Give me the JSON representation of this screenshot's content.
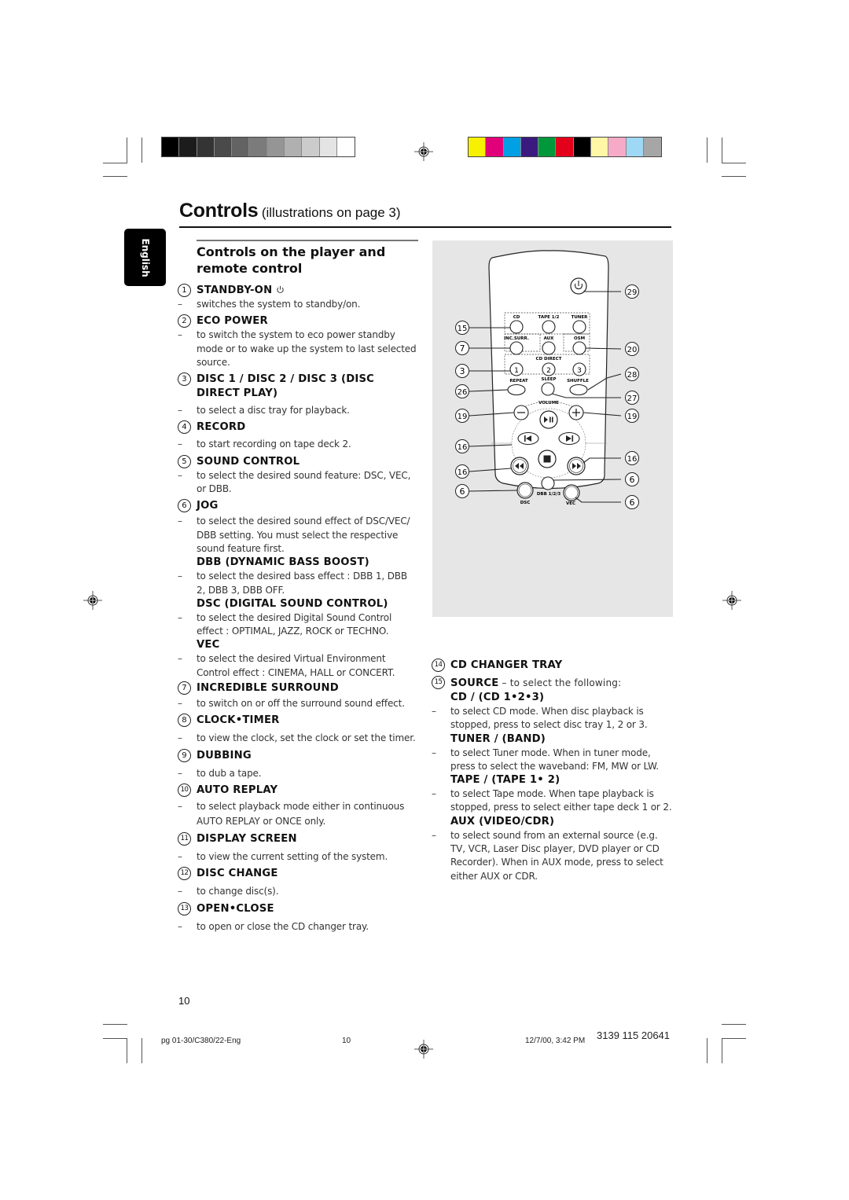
{
  "print_marks": {
    "grayscale_bars": [
      "#000000",
      "#1c1c1c",
      "#343434",
      "#4a4a4a",
      "#636363",
      "#7b7b7b",
      "#959595",
      "#b0b0b0",
      "#cbcbcb",
      "#e4e4e4",
      "#ffffff"
    ],
    "color_bars": [
      "#f7f000",
      "#e2007a",
      "#00a0e4",
      "#3a1a7f",
      "#00983a",
      "#e3001b",
      "#000000",
      "#fff7a6",
      "#f6aac6",
      "#9fd8f4",
      "#a6a6a6"
    ]
  },
  "header": {
    "title": "Controls",
    "subtitle": "(illustrations on page 3)",
    "language_tab": "English"
  },
  "section": {
    "heading_line1": "Controls on the player and",
    "heading_line2": "remote control"
  },
  "items_left": [
    {
      "num": "1",
      "title": "STANDBY-ON",
      "icon": "power-icon",
      "desc": [
        "switches the system to standby/on."
      ]
    },
    {
      "num": "2",
      "title": "ECO POWER",
      "desc": [
        "to switch the system to eco power standby mode or to wake up the system to last selected source."
      ]
    },
    {
      "num": "3",
      "title": "DISC 1 / DISC 2 / DISC 3 (DISC DIRECT PLAY)",
      "desc": [
        "to select a disc tray for playback."
      ]
    },
    {
      "num": "4",
      "title": "RECORD",
      "desc": [
        "to start recording on tape deck 2."
      ]
    },
    {
      "num": "5",
      "title": "SOUND CONTROL",
      "desc": [
        "to select the desired sound feature: DSC, VEC, or DBB."
      ]
    },
    {
      "num": "6",
      "title": "JOG",
      "desc": [
        "to select the desired sound effect of DSC/VEC/ DBB setting.  You must select the respective sound feature first."
      ],
      "subs": [
        {
          "title": "DBB (DYNAMIC BASS BOOST)",
          "desc": "to select the desired bass effect : DBB 1, DBB 2, DBB 3, DBB OFF."
        },
        {
          "title": "DSC (DIGITAL SOUND CONTROL)",
          "desc": "to select the desired Digital Sound Control effect : OPTIMAL, JAZZ, ROCK or TECHNO."
        },
        {
          "title": "VEC",
          "desc": "to select the desired Virtual Environment Control effect : CINEMA, HALL or CONCERT."
        }
      ]
    },
    {
      "num": "7",
      "title": "INCREDIBLE SURROUND",
      "desc": [
        "to switch on or off the surround sound effect."
      ]
    },
    {
      "num": "8",
      "title": "CLOCK•TIMER",
      "desc": [
        "to view the clock, set the clock or set the timer."
      ]
    },
    {
      "num": "9",
      "title": "DUBBING",
      "desc": [
        "to dub a tape."
      ]
    },
    {
      "num": "10",
      "title": "AUTO REPLAY",
      "desc": [
        "to select playback mode either in continuous AUTO REPLAY or ONCE only."
      ]
    },
    {
      "num": "11",
      "title": "DISPLAY SCREEN",
      "desc": [
        "to view the current setting of the system."
      ]
    },
    {
      "num": "12",
      "title": "DISC CHANGE",
      "desc": [
        "to change disc(s)."
      ]
    },
    {
      "num": "13",
      "title": "OPEN•CLOSE",
      "desc": [
        "to open or close the CD changer tray."
      ]
    }
  ],
  "items_right": {
    "item14": {
      "num": "14",
      "title": "CD CHANGER TRAY"
    },
    "item15": {
      "num": "15",
      "title": "SOURCE",
      "inline": " – to select the following:",
      "subs": [
        {
          "title": "CD / (CD 1•2•3)",
          "desc": "to select CD mode. When disc playback is stopped, press to select disc tray 1, 2 or 3."
        },
        {
          "title": "TUNER / (BAND)",
          "desc": "to select Tuner mode. When in tuner mode, press to select the waveband: FM, MW or LW."
        },
        {
          "title": "TAPE / (TAPE 1• 2)",
          "desc": "to select Tape mode. When tape playback is stopped, press to select either tape deck 1 or 2."
        },
        {
          "title": "AUX (VIDEO/CDR)",
          "desc": "to select sound from an external source (e.g. TV, VCR, Laser Disc player, DVD player or CD Recorder). When in AUX mode, press to select either AUX or CDR."
        }
      ]
    }
  },
  "remote": {
    "button_labels": {
      "cd": "CD",
      "tape": "TAPE 1/2",
      "tuner": "TUNER",
      "inc_surr": "INC.SURR.",
      "aux": "AUX",
      "osm": "OSM",
      "cd_direct": "CD DIRECT",
      "d1": "1",
      "d2": "2",
      "d3": "3",
      "repeat": "REPEAT",
      "sleep": "SLEEP",
      "shuffle": "SHUFFLE",
      "volume": "VOLUME",
      "dsc": "DSC",
      "dbb": "DBB 1/2/3",
      "vec": "VEC"
    },
    "callouts_left": [
      "15",
      "7",
      "3",
      "26",
      "19",
      "16",
      "16",
      "6"
    ],
    "callouts_right": [
      "29",
      "20",
      "28",
      "27",
      "19",
      "16",
      "6",
      "6"
    ]
  },
  "footer": {
    "page_number": "10",
    "file": "pg  01-30/C380/22-Eng",
    "page": "10",
    "timestamp": "12/7/00, 3:42 PM",
    "code": "3139 115 20641"
  }
}
